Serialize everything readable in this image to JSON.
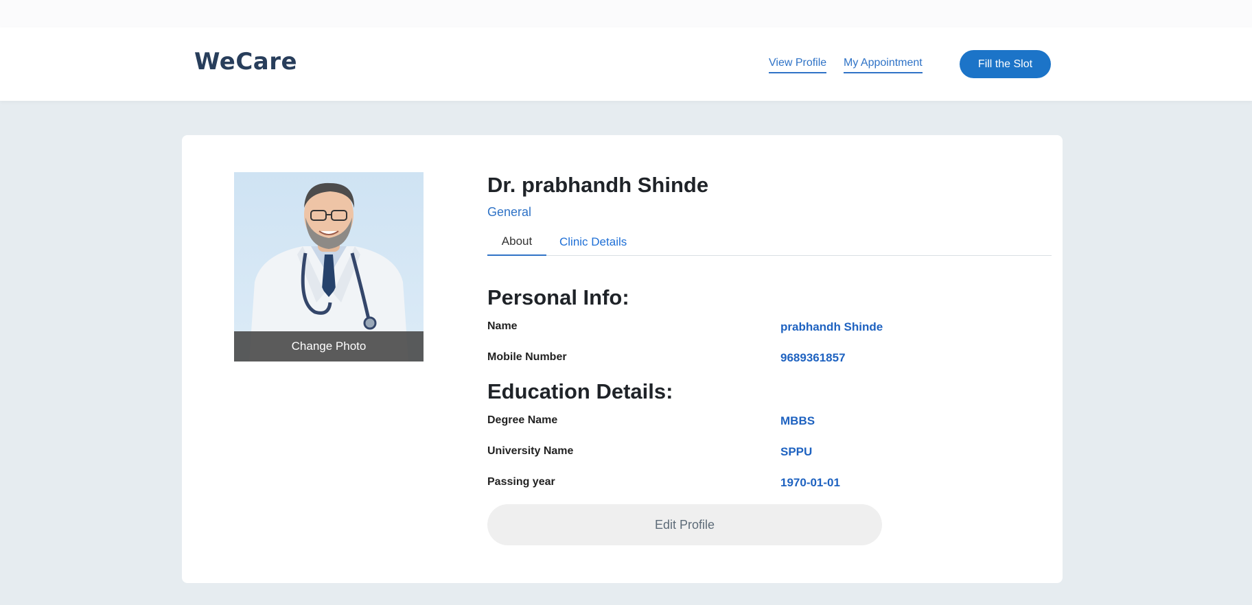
{
  "header": {
    "brand": "WeCare",
    "nav": {
      "view_profile": "View Profile",
      "my_appointment": "My Appointment",
      "fill_slot": "Fill the Slot"
    }
  },
  "profile": {
    "photo_action": "Change Photo",
    "name": "Dr. prabhandh Shinde",
    "specialization": "General",
    "tabs": [
      "About",
      "Clinic Details"
    ],
    "personal_info": {
      "title": "Personal Info:",
      "rows": [
        {
          "label": "Name",
          "value": "prabhandh Shinde"
        },
        {
          "label": "Mobile Number",
          "value": "9689361857"
        }
      ]
    },
    "education": {
      "title": "Education Details:",
      "rows": [
        {
          "label": "Degree Name",
          "value": "MBBS"
        },
        {
          "label": "University Name",
          "value": "SPPU"
        },
        {
          "label": "Passing year",
          "value": "1970-01-01"
        }
      ]
    },
    "edit_label": "Edit Profile"
  },
  "colors": {
    "accent": "#1c74c8",
    "link": "#2e72c6",
    "brand": "#283e5b",
    "page_bg": "#e6ecf0"
  },
  "icons": {
    "photo": "doctor-avatar-illustration"
  }
}
